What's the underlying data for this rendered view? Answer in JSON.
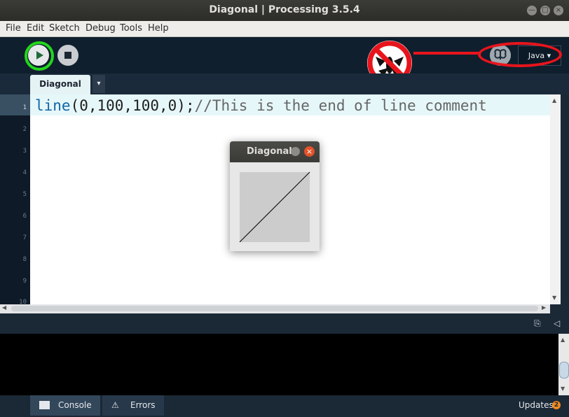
{
  "window": {
    "title": "Diagonal | Processing 3.5.4",
    "controls": {
      "minimize": "—",
      "maximize": "□",
      "close": "×"
    }
  },
  "menu": [
    "File",
    "Edit",
    "Sketch",
    "Debug",
    "Tools",
    "Help"
  ],
  "toolbar": {
    "mode": "Java ▾",
    "debug_icon": "butterfly-icon"
  },
  "tabs": {
    "active": "Diagonal",
    "menu_arrow": "▾"
  },
  "editor": {
    "line_numbers": [
      "1",
      "2",
      "3",
      "4",
      "5",
      "6",
      "7",
      "8",
      "9",
      "10"
    ],
    "code": {
      "keyword": "line",
      "args": "(0,100,100,0);",
      "comment": "//This is the end of line comment"
    }
  },
  "sketch_window": {
    "title": "Diagonal",
    "close_glyph": "×"
  },
  "console": {
    "tabs": {
      "console": "Console",
      "errors": "Errors"
    },
    "updates": {
      "label": "Updates",
      "count": "2"
    }
  },
  "colors": {
    "run_highlight": "#23d61c",
    "annotation_red": "#e8141c",
    "editor_bg": "#ffffff",
    "ide_dark": "#1b2836"
  }
}
